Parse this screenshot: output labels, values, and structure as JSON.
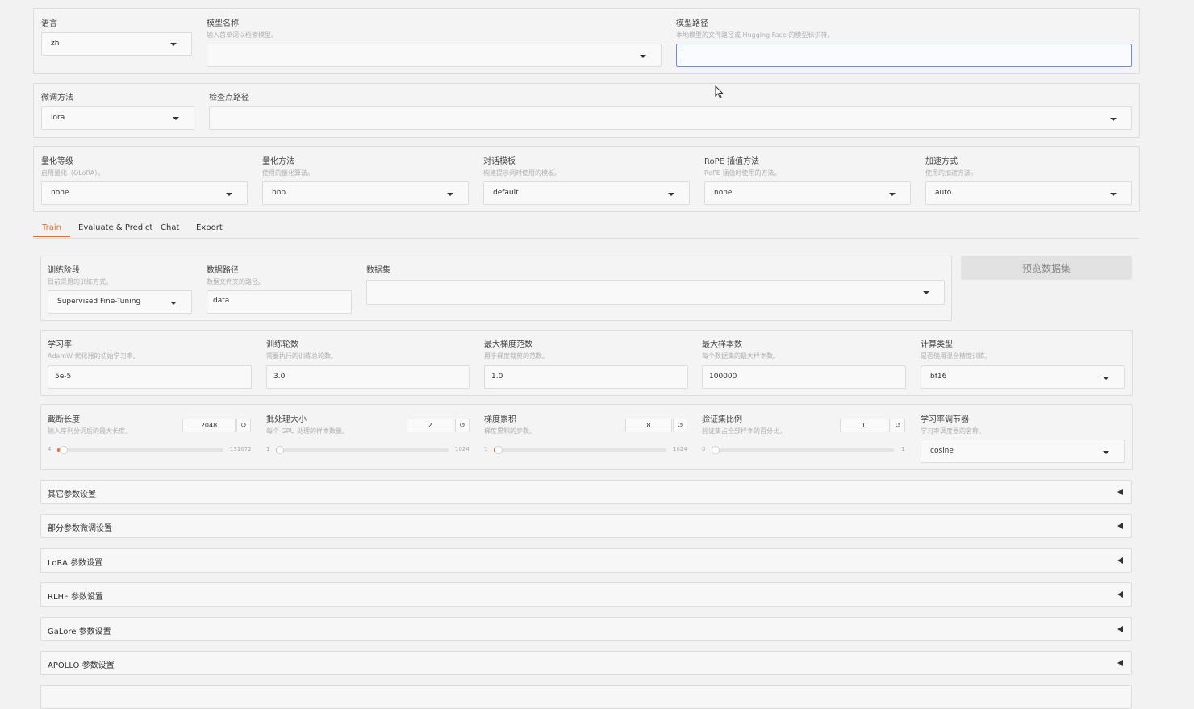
{
  "top": {
    "lang": {
      "label": "语言",
      "value": "zh"
    },
    "model_name": {
      "label": "模型名称",
      "hint": "输入首单词以检索模型。",
      "value": ""
    },
    "model_path": {
      "label": "模型路径",
      "hint": "本地模型的文件路径或 Hugging Face 的模型标识符。",
      "value": ""
    }
  },
  "row2": {
    "finetune": {
      "label": "微调方法",
      "value": "lora"
    },
    "checkpoint": {
      "label": "检查点路径",
      "value": ""
    }
  },
  "row3": [
    {
      "label": "量化等级",
      "hint": "启用量化（QLoRA）。",
      "value": "none"
    },
    {
      "label": "量化方法",
      "hint": "使用的量化算法。",
      "value": "bnb"
    },
    {
      "label": "对话模板",
      "hint": "构建提示词时使用的模板。",
      "value": "default"
    },
    {
      "label": "RoPE 插值方法",
      "hint": "RoPE 插值时使用的方法。",
      "value": "none"
    },
    {
      "label": "加速方式",
      "hint": "使用的加速方法。",
      "value": "auto"
    }
  ],
  "tabs": [
    "Train",
    "Evaluate & Predict",
    "Chat",
    "Export"
  ],
  "train": {
    "stage": {
      "label": "训练阶段",
      "hint": "目前采用的训练方式。",
      "value": "Supervised Fine-Tuning"
    },
    "data_path": {
      "label": "数据路径",
      "hint": "数据文件夹的路径。",
      "value": "data"
    },
    "dataset": {
      "label": "数据集",
      "value": ""
    },
    "preview_button": "预览数据集",
    "params": [
      {
        "label": "学习率",
        "hint": "AdamW 优化器的初始学习率。",
        "value": "5e-5"
      },
      {
        "label": "训练轮数",
        "hint": "需要执行的训练总轮数。",
        "value": "3.0"
      },
      {
        "label": "最大梯度范数",
        "hint": "用于梯度裁剪的范数。",
        "value": "1.0"
      },
      {
        "label": "最大样本数",
        "hint": "每个数据集的最大样本数。",
        "value": "100000"
      },
      {
        "label": "计算类型",
        "hint": "是否使用混合精度训练。",
        "value": "bf16"
      }
    ],
    "sliders": [
      {
        "label": "截断长度",
        "hint": "输入序列分词后的最大长度。",
        "value": "2048",
        "min": "4",
        "max": "131072",
        "fraction": 0.016
      },
      {
        "label": "批处理大小",
        "hint": "每个 GPU 处理的样本数量。",
        "value": "2",
        "min": "1",
        "max": "1024",
        "fraction": 0.001
      },
      {
        "label": "梯度累积",
        "hint": "梯度累积的步数。",
        "value": "8",
        "min": "1",
        "max": "1024",
        "fraction": 0.007
      },
      {
        "label": "验证集比例",
        "hint": "验证集占全部样本的百分比。",
        "value": "0",
        "min": "0",
        "max": "1",
        "fraction": 0.0
      }
    ],
    "scheduler": {
      "label": "学习率调节器",
      "hint": "学习率调度器的名称。",
      "value": "cosine"
    },
    "reset_glyph": "↺",
    "accordions": [
      "其它参数设置",
      "部分参数微调设置",
      "LoRA 参数设置",
      "RLHF 参数设置",
      "GaLore 参数设置",
      "APOLLO 参数设置"
    ]
  },
  "accent_color": "#e8702a"
}
